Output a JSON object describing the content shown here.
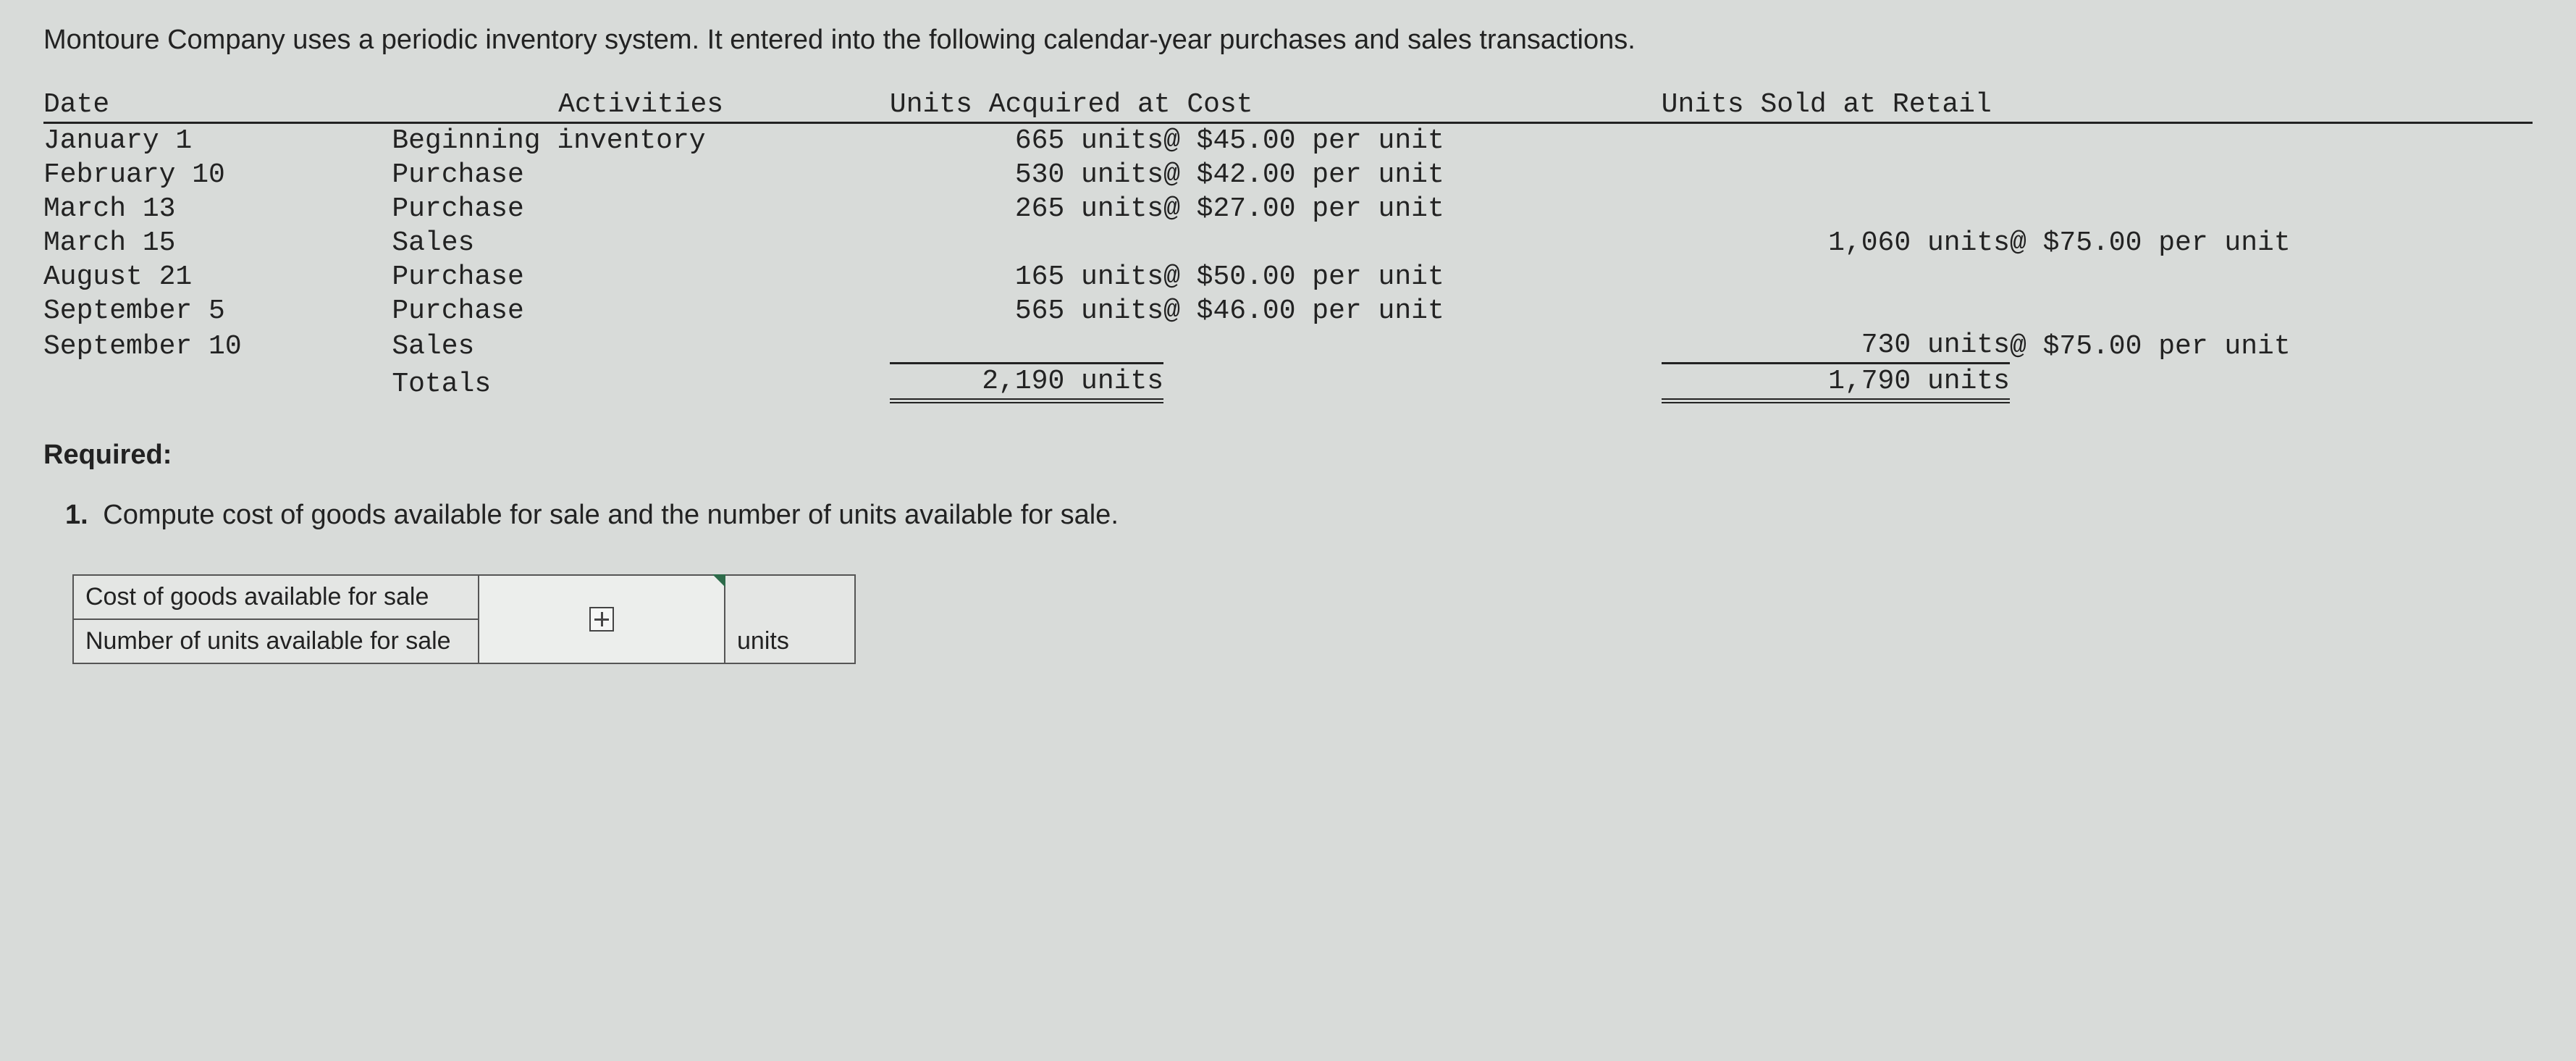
{
  "intro": "Montoure Company uses a periodic inventory system. It entered into the following calendar-year purchases and sales transactions.",
  "headers": {
    "date": "Date",
    "activities": "Activities",
    "acq": "Units Acquired at Cost",
    "sold": "Units Sold at Retail"
  },
  "rows": [
    {
      "date": "January 1",
      "activity": "Beginning inventory",
      "acq_units": "665 units",
      "acq_price": "@ $45.00 per unit",
      "sold_units": "",
      "sold_price": ""
    },
    {
      "date": "February 10",
      "activity": "Purchase",
      "acq_units": "530 units",
      "acq_price": "@ $42.00 per unit",
      "sold_units": "",
      "sold_price": ""
    },
    {
      "date": "March 13",
      "activity": "Purchase",
      "acq_units": "265 units",
      "acq_price": "@ $27.00 per unit",
      "sold_units": "",
      "sold_price": ""
    },
    {
      "date": "March 15",
      "activity": "Sales",
      "acq_units": "",
      "acq_price": "",
      "sold_units": "1,060 units",
      "sold_price": "@ $75.00 per unit"
    },
    {
      "date": "August 21",
      "activity": "Purchase",
      "acq_units": "165 units",
      "acq_price": "@ $50.00 per unit",
      "sold_units": "",
      "sold_price": ""
    },
    {
      "date": "September 5",
      "activity": "Purchase",
      "acq_units": "565 units",
      "acq_price": "@ $46.00 per unit",
      "sold_units": "",
      "sold_price": ""
    },
    {
      "date": "September 10",
      "activity": "Sales",
      "acq_units": "",
      "acq_price": "",
      "sold_units": "730 units",
      "sold_price": "@ $75.00 per unit"
    }
  ],
  "totals": {
    "label": "Totals",
    "acq_units": "2,190 units",
    "sold_units": "1,790 units"
  },
  "required_label": "Required:",
  "question": {
    "num": "1.",
    "text": "Compute cost of goods available for sale and the number of units available for sale."
  },
  "answer_labels": {
    "cogas": "Cost of goods available for sale",
    "units": "Number of units available for sale",
    "units_suffix": "units"
  }
}
